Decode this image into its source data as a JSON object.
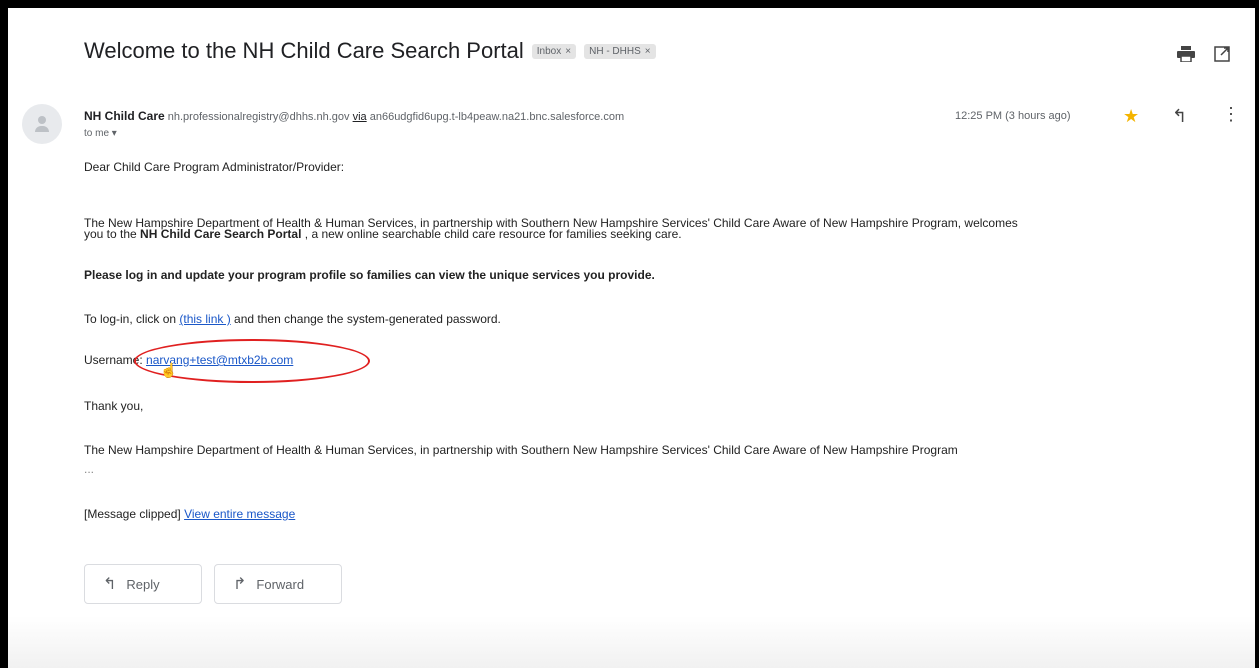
{
  "email": {
    "subject": "Welcome to the NH Child Care Search Portal",
    "labels": [
      {
        "name": "Inbox",
        "close": "×"
      },
      {
        "name": "NH - DHHS",
        "close": "×"
      }
    ],
    "sender": {
      "name": "NH Child Care",
      "address": "nh.professionalregistry@dhhs.nh.gov",
      "via_text": "via",
      "via_domain": "an66udgfid6upg.t-lb4peaw.na21.bnc.salesforce.com"
    },
    "to": "to me ▾",
    "time": "12:25 PM (3 hours ago)",
    "body": {
      "greeting": "Dear Child Care Program Administrator/Provider:",
      "para1_line1": "The New Hampshire Department of Health & Human Services, in partnership with Southern New Hampshire Services' Child Care Aware of New Hampshire Program, welcomes",
      "para1_line2_pre": "you to the ",
      "para1_line2_bold": "NH Child Care Search Portal",
      "para1_line2_post": " , a new online searchable child care resource for families seeking care.",
      "instruction": "Please log in and update your program profile so families can view the unique services you provide.",
      "login_pre": "To log-in, click on ",
      "login_link": "(this link )",
      "login_post": " and then change the system-generated password.",
      "username_label": "Username: ",
      "username_value": "narvang+test@mtxb2b.com",
      "thanks": "Thank you,",
      "signature": "The New Hampshire Department of Health & Human Services, in partnership with Southern New Hampshire Services' Child Care Aware of New Hampshire Program",
      "dots": "...",
      "clipped": "[Message clipped]",
      "view_entire": "View entire message"
    },
    "actions": {
      "reply": "Reply",
      "forward": "Forward"
    }
  },
  "colors": {
    "link": "#1a57c8",
    "annotation": "#e02020",
    "star": "#f4b400"
  }
}
